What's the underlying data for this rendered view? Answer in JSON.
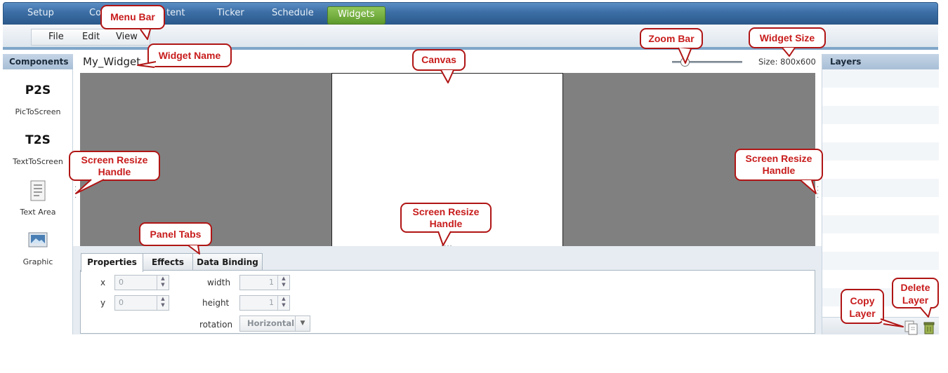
{
  "nav": {
    "tabs": [
      {
        "label": "Setup"
      },
      {
        "label": "Co"
      },
      {
        "label": "tent"
      },
      {
        "label": "Ticker"
      },
      {
        "label": "Schedule"
      },
      {
        "label": "Widgets",
        "active": true
      }
    ]
  },
  "menu": {
    "items": [
      {
        "label": "File"
      },
      {
        "label": "Edit"
      },
      {
        "label": "View"
      }
    ]
  },
  "components": {
    "header": "Components",
    "items": [
      {
        "big": "P2S",
        "label": "PicToScreen"
      },
      {
        "big": "T2S",
        "label": "TextToScreen"
      },
      {
        "icon": "text-area-icon",
        "label": "Text Area"
      },
      {
        "icon": "graphic-icon",
        "label": "Graphic"
      }
    ]
  },
  "widget": {
    "name": "My_Widget",
    "size_label": "Size: 800x600"
  },
  "layers": {
    "header": "Layers"
  },
  "panel": {
    "tabs": [
      {
        "label": "Properties",
        "active": true
      },
      {
        "label": "Effects"
      },
      {
        "label": "Data Binding"
      }
    ],
    "fields": {
      "x": {
        "label": "x",
        "value": "0"
      },
      "y": {
        "label": "y",
        "value": "0"
      },
      "width": {
        "label": "width",
        "value": "1"
      },
      "height": {
        "label": "height",
        "value": "1"
      },
      "rotation": {
        "label": "rotation",
        "value": "Horizontal"
      }
    }
  },
  "annotations": {
    "menu_bar": "Menu Bar",
    "widget_name": "Widget Name",
    "canvas": "Canvas",
    "zoom_bar": "Zoom Bar",
    "widget_size": "Widget Size",
    "screen_resize_handle": "Screen Resize Handle",
    "panel_tabs": "Panel Tabs",
    "copy_layer": "Copy Layer",
    "delete_layer": "Delete Layer"
  },
  "colors": {
    "nav_blue": "#3c6ea5",
    "active_tab_green": "#6fae3a",
    "stage_gray": "#808080",
    "callout_red": "#c81c1c"
  }
}
